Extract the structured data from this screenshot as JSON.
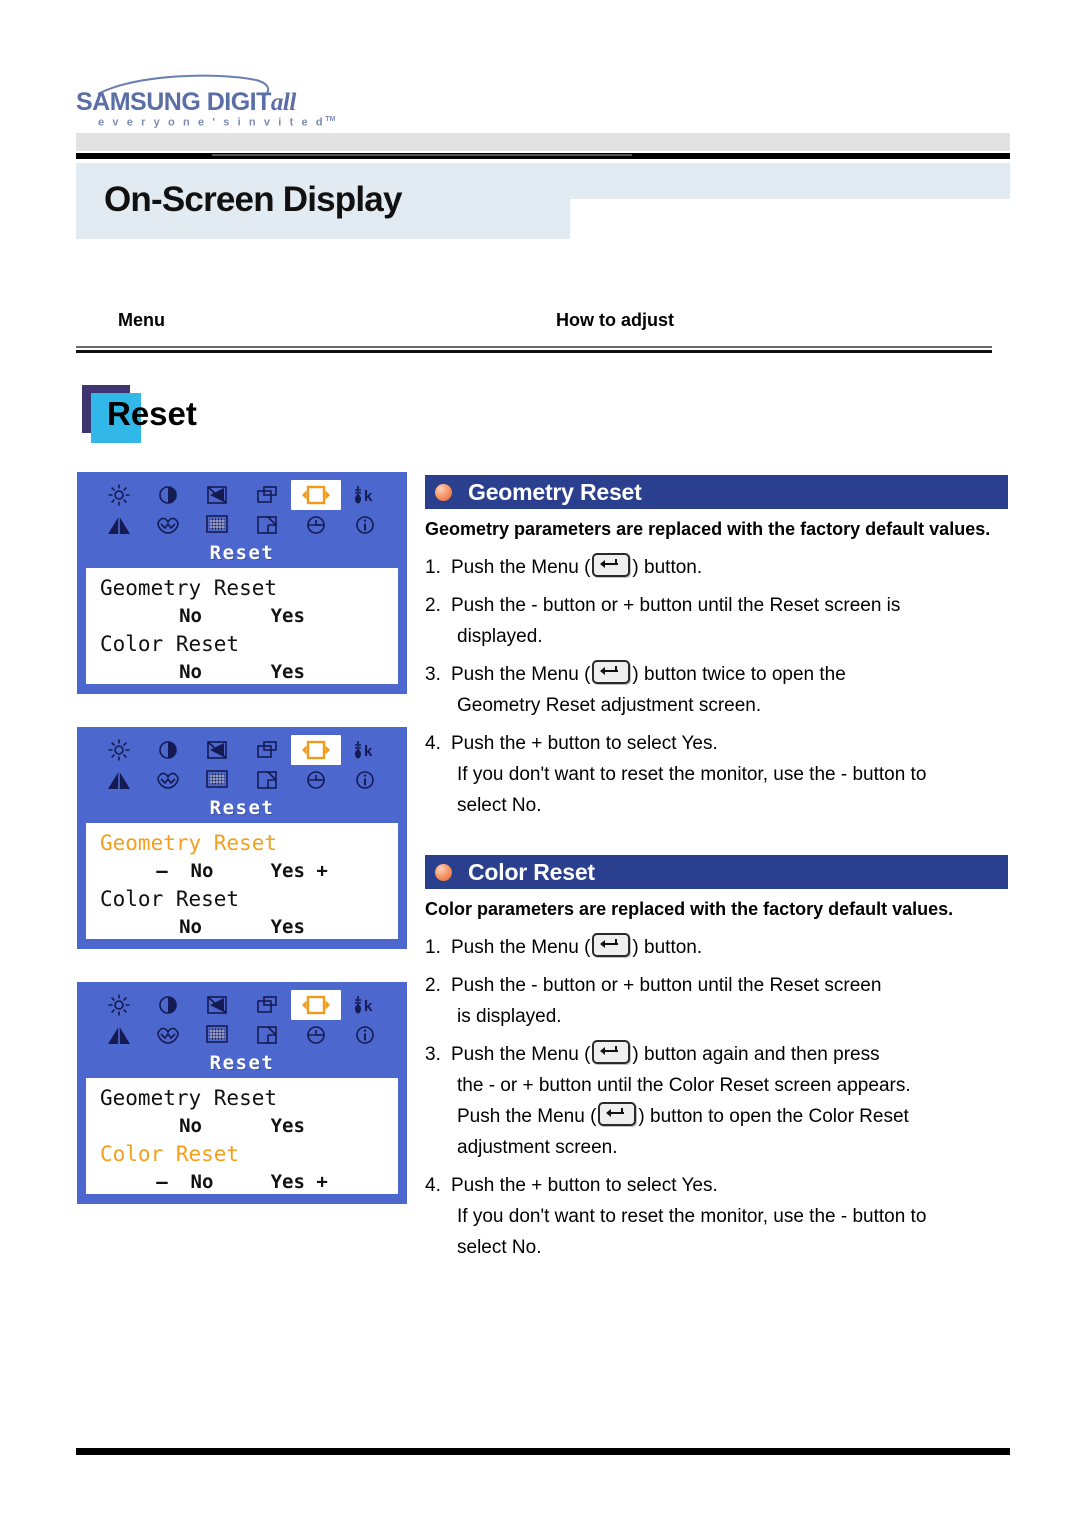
{
  "brand": {
    "name": "SAMSUNG DIGIT",
    "name_italic": "all",
    "tagline": "e v e r y o n e ' s   i n v i t e d",
    "tagline_tm": "TM",
    "logo_color": "#5b6fa6"
  },
  "header": {
    "page_title": "On-Screen Display",
    "title_band_color": "#e2ebf1"
  },
  "columns": {
    "menu_label": "Menu",
    "how_to_adjust_label": "How to adjust"
  },
  "menu_heading": {
    "label": "Reset",
    "square_color": "#32b8e8",
    "shadow_color": "#3d3470"
  },
  "osd": {
    "panel_color": "#4c68cf",
    "selected_color": "#f2a01e",
    "title": "Reset",
    "icons": [
      {
        "name": "brightness-icon",
        "selected": false
      },
      {
        "name": "contrast-icon",
        "selected": false
      },
      {
        "name": "horizontal-position-icon",
        "selected": false
      },
      {
        "name": "horizontal-size-icon",
        "selected": false
      },
      {
        "name": "reset-icon",
        "selected": true
      },
      {
        "name": "color-temperature-icon",
        "selected": false
      },
      {
        "name": "pincushion-icon",
        "selected": false
      },
      {
        "name": "trapezoid-icon",
        "selected": false
      },
      {
        "name": "moire-icon",
        "selected": false
      },
      {
        "name": "vertical-size-icon",
        "selected": false
      },
      {
        "name": "degauss-icon",
        "selected": false
      },
      {
        "name": "information-icon",
        "selected": false
      }
    ],
    "panels": [
      {
        "id": "reset-overview",
        "rows": [
          {
            "label": "Geometry Reset",
            "selected": false,
            "options": "No      Yes",
            "show_pm": false
          },
          {
            "label": "Color Reset",
            "selected": false,
            "options": "No      Yes",
            "show_pm": false
          }
        ]
      },
      {
        "id": "geometry-reset-selected",
        "rows": [
          {
            "label": "Geometry Reset",
            "selected": true,
            "options": "–  No     Yes +",
            "show_pm": true
          },
          {
            "label": "Color Reset",
            "selected": false,
            "options": "No      Yes",
            "show_pm": false
          }
        ]
      },
      {
        "id": "color-reset-selected",
        "rows": [
          {
            "label": "Geometry Reset",
            "selected": false,
            "options": "No      Yes",
            "show_pm": false
          },
          {
            "label": "Color Reset",
            "selected": true,
            "options": "–  No     Yes +",
            "show_pm": true
          }
        ]
      }
    ]
  },
  "sections": [
    {
      "id": "geometry-reset",
      "title": "Geometry Reset",
      "bar_color": "#2b3f8f",
      "description": "Geometry parameters are replaced with the factory default values.",
      "steps": [
        {
          "num": "1.",
          "parts": [
            {
              "type": "text",
              "value": "Push the Menu ("
            },
            {
              "type": "icon",
              "value": "menu-button-icon"
            },
            {
              "type": "text",
              "value": ") button."
            }
          ]
        },
        {
          "num": "2.",
          "parts": [
            {
              "type": "text",
              "value": "Push the - button or + button until the Reset screen is displayed."
            }
          ]
        },
        {
          "num": "3.",
          "parts": [
            {
              "type": "text",
              "value": "Push the Menu ("
            },
            {
              "type": "icon",
              "value": "menu-button-icon"
            },
            {
              "type": "text",
              "value": ") button twice to open the Geometry Reset adjustment screen."
            }
          ]
        },
        {
          "num": "4.",
          "lines": [
            "Push the + button to select Yes.",
            "If you don't want to reset the monitor, use the - button to select No."
          ]
        }
      ]
    },
    {
      "id": "color-reset",
      "title": "Color Reset",
      "bar_color": "#2b3f8f",
      "description": "Color parameters are replaced with the factory default values.",
      "steps": [
        {
          "num": "1.",
          "parts": [
            {
              "type": "text",
              "value": "Push the Menu ("
            },
            {
              "type": "icon",
              "value": "menu-button-icon"
            },
            {
              "type": "text",
              "value": ") button."
            }
          ]
        },
        {
          "num": "2.",
          "parts": [
            {
              "type": "text",
              "value": "Push the - button or + button until the Reset screen is displayed."
            }
          ]
        },
        {
          "num": "3.",
          "parts": [
            {
              "type": "text",
              "value": "Push the Menu ("
            },
            {
              "type": "icon",
              "value": "menu-button-icon"
            },
            {
              "type": "text",
              "value": ") button again and then press the - or + button until the Color Reset screen appears. Push the Menu ("
            },
            {
              "type": "icon",
              "value": "menu-button-icon"
            },
            {
              "type": "text",
              "value": ") button to open the Color Reset adjustment screen."
            }
          ]
        },
        {
          "num": "4.",
          "lines": [
            "Push the + button to select Yes.",
            "If you don't want to reset the monitor, use the - button to select No."
          ]
        }
      ]
    }
  ],
  "geometry_steps_text": {
    "s1_a": "Push the Menu (",
    "s1_b": ") button.",
    "s2": "Push the - button or + button until the Reset screen is",
    "s2b": "displayed.",
    "s3_a": "Push the Menu (",
    "s3_b": ") button twice to open the",
    "s3_c": "Geometry Reset adjustment screen.",
    "s4_a": "Push the + button to select Yes.",
    "s4_b": "If you don't want to reset the monitor, use the - button to",
    "s4_c": "select No."
  },
  "color_steps_text": {
    "s1_a": "Push the Menu (",
    "s1_b": ") button.",
    "s2": "Push the - button or + button until the Reset screen",
    "s2b": "is displayed.",
    "s3_a": "Push the Menu (",
    "s3_b": ") button again and then press",
    "s3_c": "the - or + button until the Color Reset screen appears.",
    "s3_d": "Push the Menu (",
    "s3_e": ") button to open the Color Reset",
    "s3_f": "adjustment screen.",
    "s4_a": "Push the + button to select Yes.",
    "s4_b": "If you don't want to reset the monitor, use the - button to",
    "s4_c": "select No."
  }
}
